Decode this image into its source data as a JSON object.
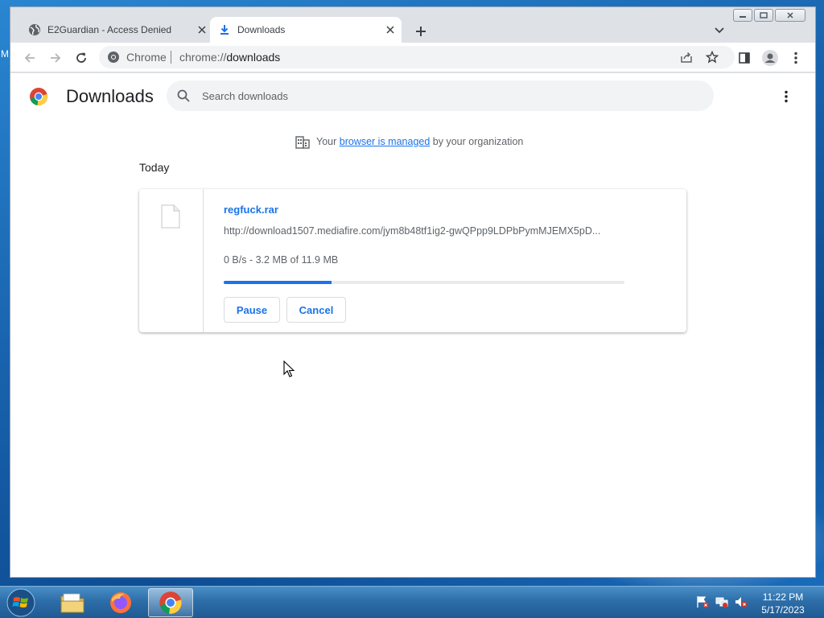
{
  "desktop": {
    "edge_char": "M"
  },
  "tabs": [
    {
      "title": "E2Guardian - Access Denied",
      "icon": "globe-icon"
    },
    {
      "title": "Downloads",
      "icon": "download-icon",
      "active": true
    }
  ],
  "omnibox": {
    "site_label": "Chrome",
    "url_scheme": "chrome://",
    "url_host": "downloads"
  },
  "page": {
    "title": "Downloads",
    "search_placeholder": "Search downloads",
    "managed": {
      "prefix": "Your",
      "link": "browser is managed",
      "suffix": "by your organization"
    },
    "section_date": "Today"
  },
  "download": {
    "file_name": "regfuck.rar",
    "url": "http://download1507.mediafire.com/jym8b48tf1ig2-gwQPpp9LDPbPymMJEMX5pD...",
    "status": "0 B/s - 3.2 MB of 11.9 MB",
    "progress_fraction": 0.27,
    "pause_label": "Pause",
    "cancel_label": "Cancel"
  },
  "taskbar": {
    "apps": [
      "explorer",
      "firefox",
      "chrome"
    ],
    "time": "11:22 PM",
    "date": "5/17/2023"
  },
  "colors": {
    "accent": "#1a73e8",
    "text": "#202124",
    "muted": "#5f6368"
  }
}
